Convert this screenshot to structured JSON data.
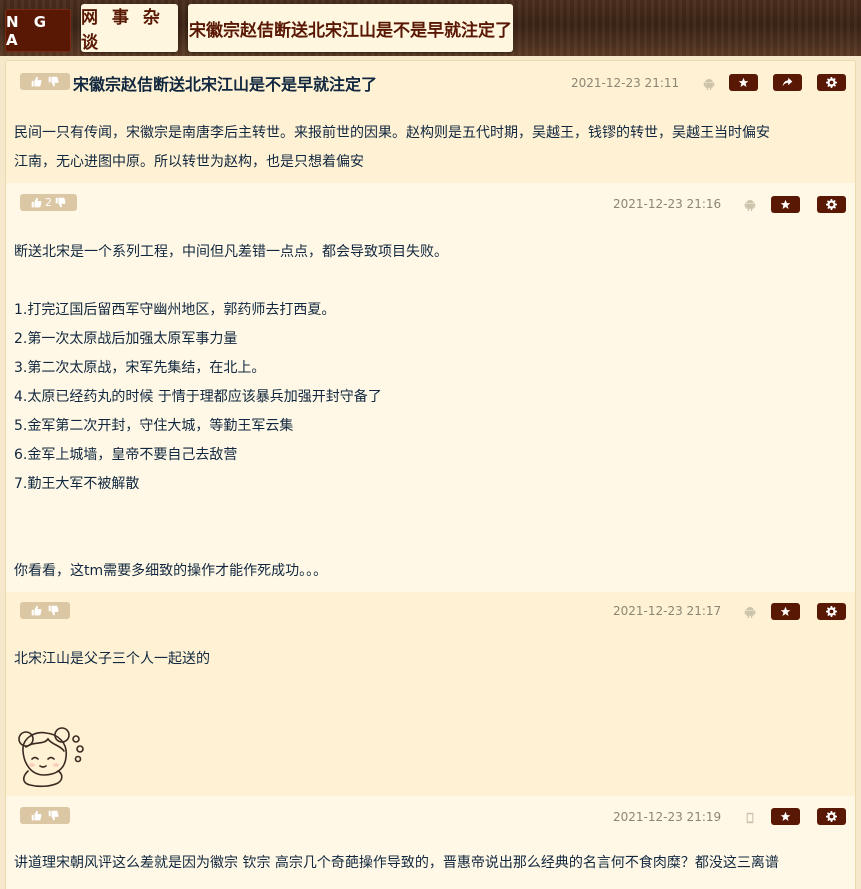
{
  "header": {
    "logo": "N G A",
    "board": "网 事 杂 谈",
    "topic": "宋徽宗赵佶断送北宋江山是不是早就注定了"
  },
  "posts": [
    {
      "title": "宋徽宗赵佶断送北宋江山是不是早就注定了",
      "votes": "",
      "date": "2021-12-23 21:11",
      "device": "android-icon",
      "content": "民间一只有传闻，宋徽宗是南唐李后主转世。来报前世的因果。赵构则是五代时期，吴越王，钱镠的转世，吴越王当时偏安\n江南，无心进图中原。所以转世为赵构，也是只想着偏安"
    },
    {
      "votes": "2",
      "date": "2021-12-23 21:16",
      "device": "android-icon",
      "content": "断送北宋是一个系列工程，中间但凡差错一点点，都会导致项目失败。\n\n1.打完辽国后留西军守幽州地区，郭药师去打西夏。\n2.第一次太原战后加强太原军事力量\n3.第二次太原战，宋军先集结，在北上。\n4.太原已经药丸的时候 于情于理都应该暴兵加强开封守备了\n5.金军第二次开封，守住大城，等勤王军云集\n6.金军上城墙，皇帝不要自己去敌营\n7.勤王大军不被解散\n\n\n你看看，这tm需要多细致的操作才能作死成功。。。"
    },
    {
      "votes": "",
      "date": "2021-12-23 21:17",
      "device": "android-icon",
      "content": "北宋江山是父子三个人一起送的"
    },
    {
      "votes": "",
      "date": "2021-12-23 21:19",
      "device": "phone-icon",
      "content": "讲道理宋朝风评这么差就是因为徽宗 钦宗 高宗几个奇葩操作导致的，晋惠帝说出那么经典的名言何不食肉糜？都没这三离谱"
    }
  ],
  "colors": {
    "accent": "#591804",
    "post_bg_alt": "#fff2d4",
    "post_bg": "#fff8e6",
    "text": "#10273f",
    "date": "#8b8673"
  },
  "icons": {
    "favorite": "star-icon",
    "share": "share-icon",
    "settings": "gear-icon",
    "like": "thumbs-up-icon",
    "dislike": "thumbs-down-icon"
  }
}
